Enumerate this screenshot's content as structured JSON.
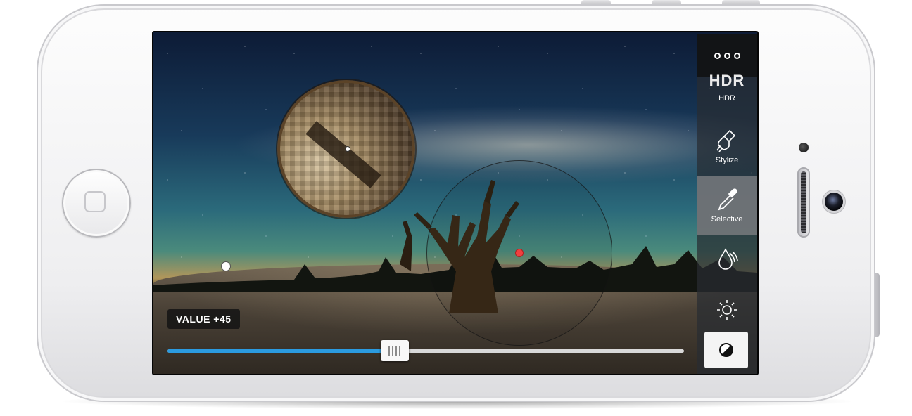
{
  "editor": {
    "value_label": "VALUE +45",
    "slider_fraction": 0.44,
    "accent_color": "#2b9be0",
    "control_point_color": "#f04040"
  },
  "toolbar": {
    "more_icon": "more-dots-icon",
    "items": [
      {
        "label": "HDR",
        "glyph": "HDR",
        "icon": "hdr-icon"
      },
      {
        "label": "Stylize",
        "icon": "brush-icon"
      },
      {
        "label": "Selective",
        "icon": "eyedropper-icon",
        "selected": true
      },
      {
        "label": "",
        "icon": "drop-icon"
      },
      {
        "label": "",
        "icon": "sun-icon"
      },
      {
        "label": "",
        "icon": "contrast-icon"
      }
    ]
  }
}
